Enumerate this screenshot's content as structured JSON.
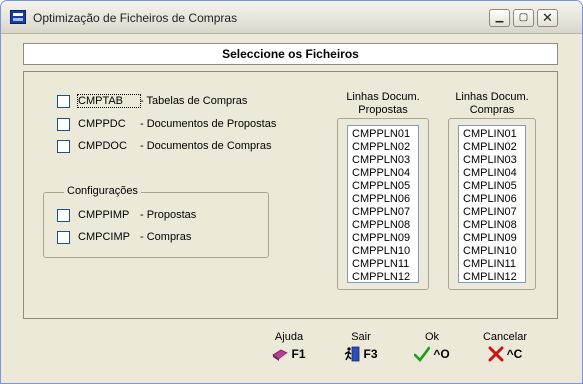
{
  "window": {
    "title": "Optimização de Ficheiros de Compras",
    "min_glyph": "▁",
    "max_glyph": "▢",
    "close_glyph": "✕"
  },
  "header": {
    "title": "Seleccione os Ficheiros"
  },
  "files": [
    {
      "code": "CMPTAB",
      "desc": "- Tabelas de Compras",
      "checked": false
    },
    {
      "code": "CMPPDC",
      "desc": "- Documentos de Propostas",
      "checked": false
    },
    {
      "code": "CMPDOC",
      "desc": "- Documentos de Compras",
      "checked": false
    }
  ],
  "configuracoes": {
    "label": "Configurações",
    "items": [
      {
        "code": "CMPPIMP",
        "desc": "- Propostas",
        "checked": false
      },
      {
        "code": "CMPCIMP",
        "desc": "- Compras",
        "checked": false
      }
    ]
  },
  "propostas": {
    "caption_line1": "Linhas Docum.",
    "caption_line2": "Propostas",
    "items": [
      "CMPPLN01",
      "CMPPLN02",
      "CMPPLN03",
      "CMPPLN04",
      "CMPPLN05",
      "CMPPLN06",
      "CMPPLN07",
      "CMPPLN08",
      "CMPPLN09",
      "CMPPLN10",
      "CMPPLN11",
      "CMPPLN12"
    ]
  },
  "compras": {
    "caption_line1": "Linhas Docum.",
    "caption_line2": "Compras",
    "items": [
      "CMPLIN01",
      "CMPLIN02",
      "CMPLIN03",
      "CMPLIN04",
      "CMPLIN05",
      "CMPLIN06",
      "CMPLIN07",
      "CMPLIN08",
      "CMPLIN09",
      "CMPLIN10",
      "CMPLIN11",
      "CMPLIN12"
    ]
  },
  "buttons": {
    "help": {
      "label": "Ajuda",
      "key": "F1",
      "icon": "book-icon"
    },
    "exit": {
      "label": "Sair",
      "key": "F3",
      "icon": "exit-door-icon"
    },
    "ok": {
      "label": "Ok",
      "key": "^O",
      "icon": "checkmark-icon"
    },
    "cancel": {
      "label": "Cancelar",
      "key": "^C",
      "icon": "red-x-icon"
    }
  },
  "colors": {
    "ok_green": "#1a9e1a",
    "cancel_red": "#cc1111",
    "book_purple": "#b0408f"
  }
}
